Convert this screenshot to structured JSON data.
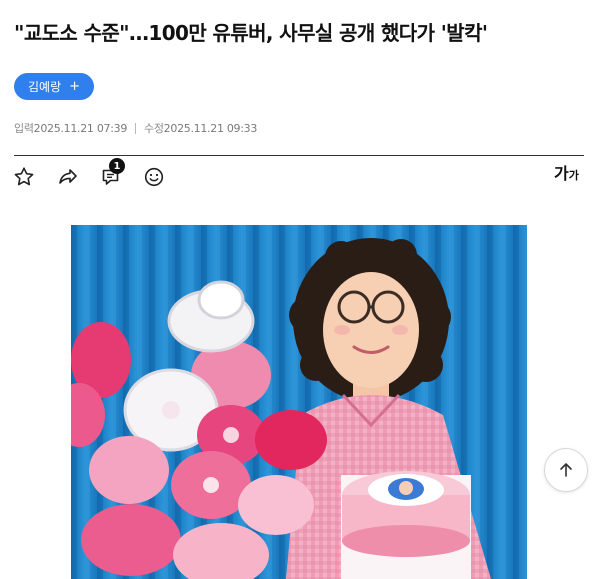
{
  "article": {
    "headline": "\"교도소 수준\"…100만 유튜버, 사무실 공개 했다가 '발칵'",
    "reporter": {
      "name": "김예랑",
      "follow_symbol": "+"
    },
    "published": {
      "label": "입력",
      "value": "2025.11.21 07:39"
    },
    "modified": {
      "label": "수정",
      "value": "2025.11.21 09:33"
    }
  },
  "toolbar": {
    "bookmark_icon": "star-outline-icon",
    "share_icon": "share-arrow-icon",
    "comment_icon": "comment-icon",
    "comment_count": "1",
    "reaction_icon": "smiley-icon",
    "font_size": {
      "large": "가",
      "small": "가"
    }
  },
  "photo": {
    "description_icon": "article-photo",
    "background_color": "#1d80c6"
  },
  "floating": {
    "scroll_top_icon": "arrow-up-icon"
  },
  "colors": {
    "accent": "#2f80ed",
    "text": "#111111",
    "muted": "#7a7a7a"
  }
}
